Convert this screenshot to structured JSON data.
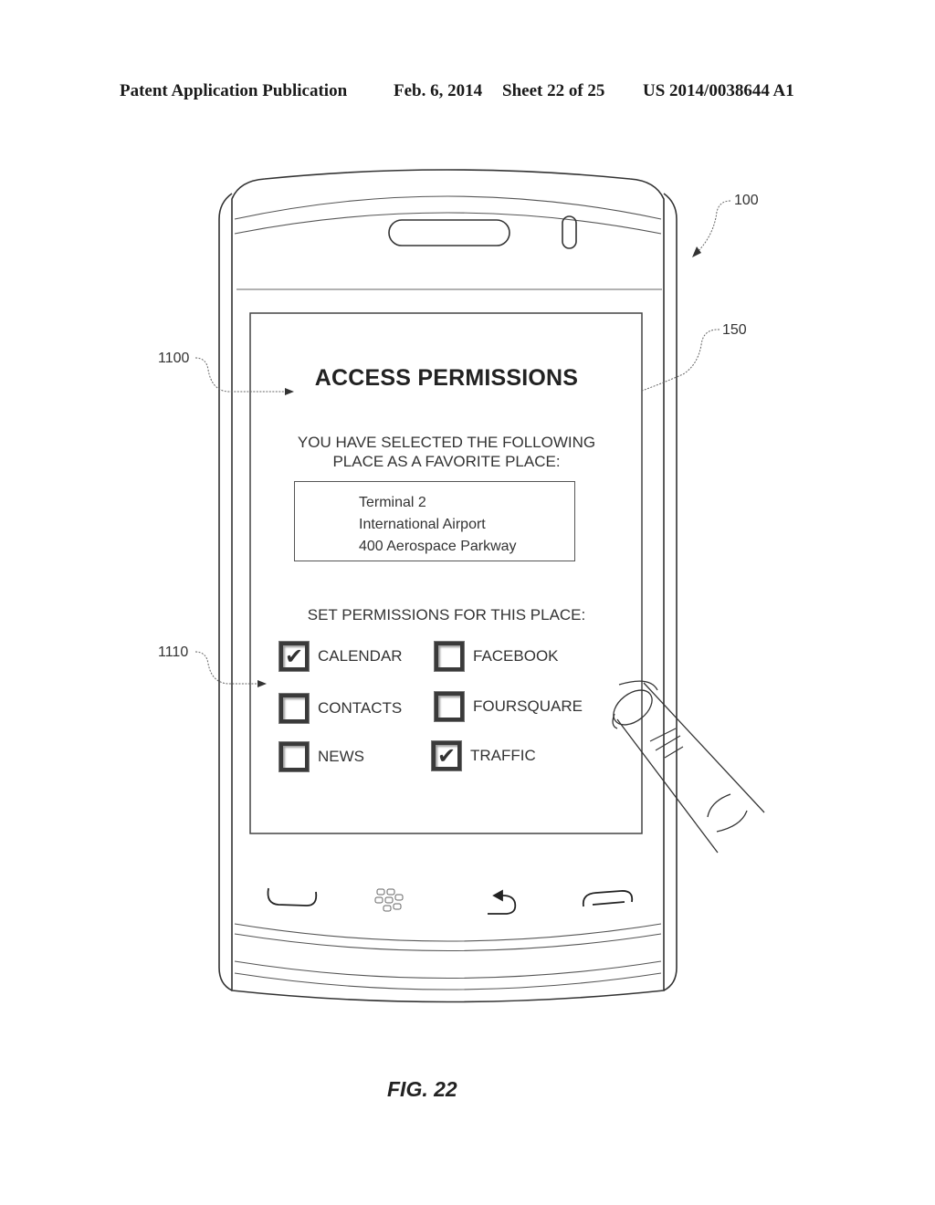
{
  "header": {
    "publication": "Patent Application Publication",
    "date": "Feb. 6, 2014",
    "sheet": "Sheet 22 of 25",
    "number": "US 2014/0038644 A1"
  },
  "references": {
    "device": "100",
    "display": "150",
    "screen": "1100",
    "permissions": "1110"
  },
  "screen": {
    "title": "ACCESS PERMISSIONS",
    "subtitle_line1": "YOU HAVE SELECTED THE FOLLOWING",
    "subtitle_line2": "PLACE AS A FAVORITE PLACE:",
    "place": {
      "line1": "Terminal 2",
      "line2": "International Airport",
      "line3": "400 Aerospace Parkway"
    },
    "permissions_heading": "SET PERMISSIONS FOR THIS PLACE:",
    "permissions": [
      {
        "label": "CALENDAR",
        "checked": true
      },
      {
        "label": "CONTACTS",
        "checked": false
      },
      {
        "label": "NEWS",
        "checked": false
      },
      {
        "label": "FACEBOOK",
        "checked": false
      },
      {
        "label": "FOURSQUARE",
        "checked": false
      },
      {
        "label": "TRAFFIC",
        "checked": true
      }
    ],
    "check_glyph": "✔"
  },
  "device_buttons": [
    "call-button",
    "menu-button",
    "back-button",
    "end-call-button"
  ],
  "figure": {
    "caption": "FIG. 22"
  }
}
